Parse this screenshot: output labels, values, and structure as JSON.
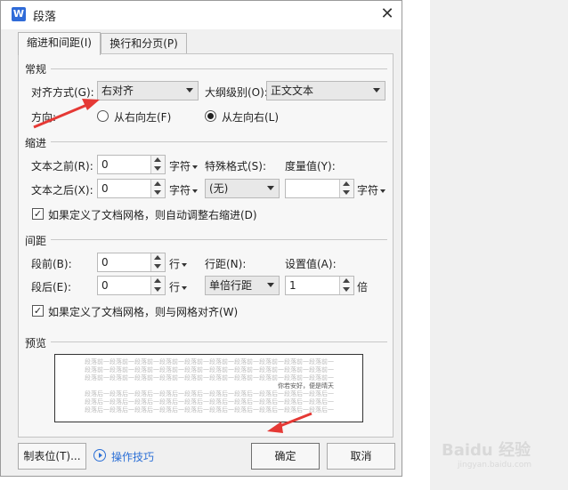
{
  "dialog": {
    "title": "段落",
    "app_icon": "W",
    "close_label": "✕",
    "tabs": [
      "缩进和间距(I)",
      "换行和分页(P)"
    ]
  },
  "general": {
    "section": "常规",
    "alignment_label": "对齐方式(G):",
    "alignment_value": "右对齐",
    "outline_label": "大纲级别(O):",
    "outline_value": "正文文本",
    "direction_label": "方向:",
    "rtl_label": "从右向左(F)",
    "ltr_label": "从左向右(L)"
  },
  "indent": {
    "section": "缩进",
    "before_label": "文本之前(R):",
    "before_value": "0",
    "before_unit": "字符",
    "after_label": "文本之后(X):",
    "after_value": "0",
    "after_unit": "字符",
    "special_label": "特殊格式(S):",
    "special_value": "(无)",
    "measure_label": "度量值(Y):",
    "measure_value": "",
    "measure_unit": "字符",
    "auto_adjust_label": "如果定义了文档网格，则自动调整右缩进(D)"
  },
  "spacing": {
    "section": "间距",
    "before_label": "段前(B):",
    "before_value": "0",
    "before_unit": "行",
    "after_label": "段后(E):",
    "after_value": "0",
    "after_unit": "行",
    "line_label": "行距(N):",
    "line_value": "单倍行距",
    "setting_label": "设置值(A):",
    "setting_value": "1",
    "setting_unit": "倍",
    "snap_grid_label": "如果定义了文档网格，则与网格对齐(W)"
  },
  "preview": {
    "section": "预览",
    "sample_line": "段落前一段落前一段落前一段落前一段落前一段落前一段落前一段落前一段落前一段落前一段落前一段落前一段落前",
    "current_text": "你若安好，便是晴天",
    "after_line": "段落后一段落后一段落后一段落后一段落后一段落后一段落后一段落后一段落后一段落后一段落后一段落后一段落后"
  },
  "footer": {
    "tab_stops_label": "制表位(T)...",
    "tips_label": "操作技巧",
    "ok_label": "确定",
    "cancel_label": "取消"
  },
  "watermark": {
    "logo": "Baidu 经验",
    "url": "jingyan.baidu.com"
  },
  "colors": {
    "arrow": "#e53935",
    "link": "#2b6fd6",
    "dialog_bg": "#f0f0f0"
  }
}
